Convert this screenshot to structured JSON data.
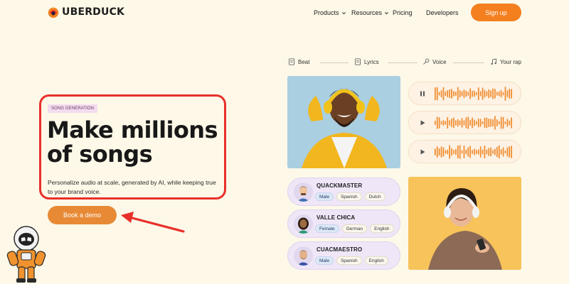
{
  "nav": {
    "logo_text": "UBERDUCK",
    "products": "Products",
    "resources": "Resources",
    "pricing": "Pricing",
    "developers": "Developers",
    "signup": "Sign up"
  },
  "hero": {
    "badge": "SONG GENERATION",
    "headline": "Make millions of songs",
    "subtext": "Personalize audio at scale, generated by AI, while keeping true to your brand voice.",
    "cta": "Book a demo"
  },
  "steps": [
    "Beat",
    "Lyrics",
    "Voice",
    "Your rap"
  ],
  "players": [
    {
      "state": "pause-icon"
    },
    {
      "state": "play-icon"
    },
    {
      "state": "play-icon"
    }
  ],
  "voices": [
    {
      "name": "QUACKMASTER",
      "tags": [
        "Male",
        "Spanish",
        "Dutch"
      ]
    },
    {
      "name": "VALLE CHICA",
      "tags": [
        "Female",
        "German",
        "English"
      ]
    },
    {
      "name": "CUACMAESTRO",
      "tags": [
        "Male",
        "Spanish",
        "English"
      ]
    }
  ],
  "colors": {
    "background": "#fdf8e8",
    "accent_orange": "#f47f1f",
    "highlight_red": "#e8302a",
    "wave_orange": "#f08a2c",
    "voice_card": "#efe6f7"
  }
}
